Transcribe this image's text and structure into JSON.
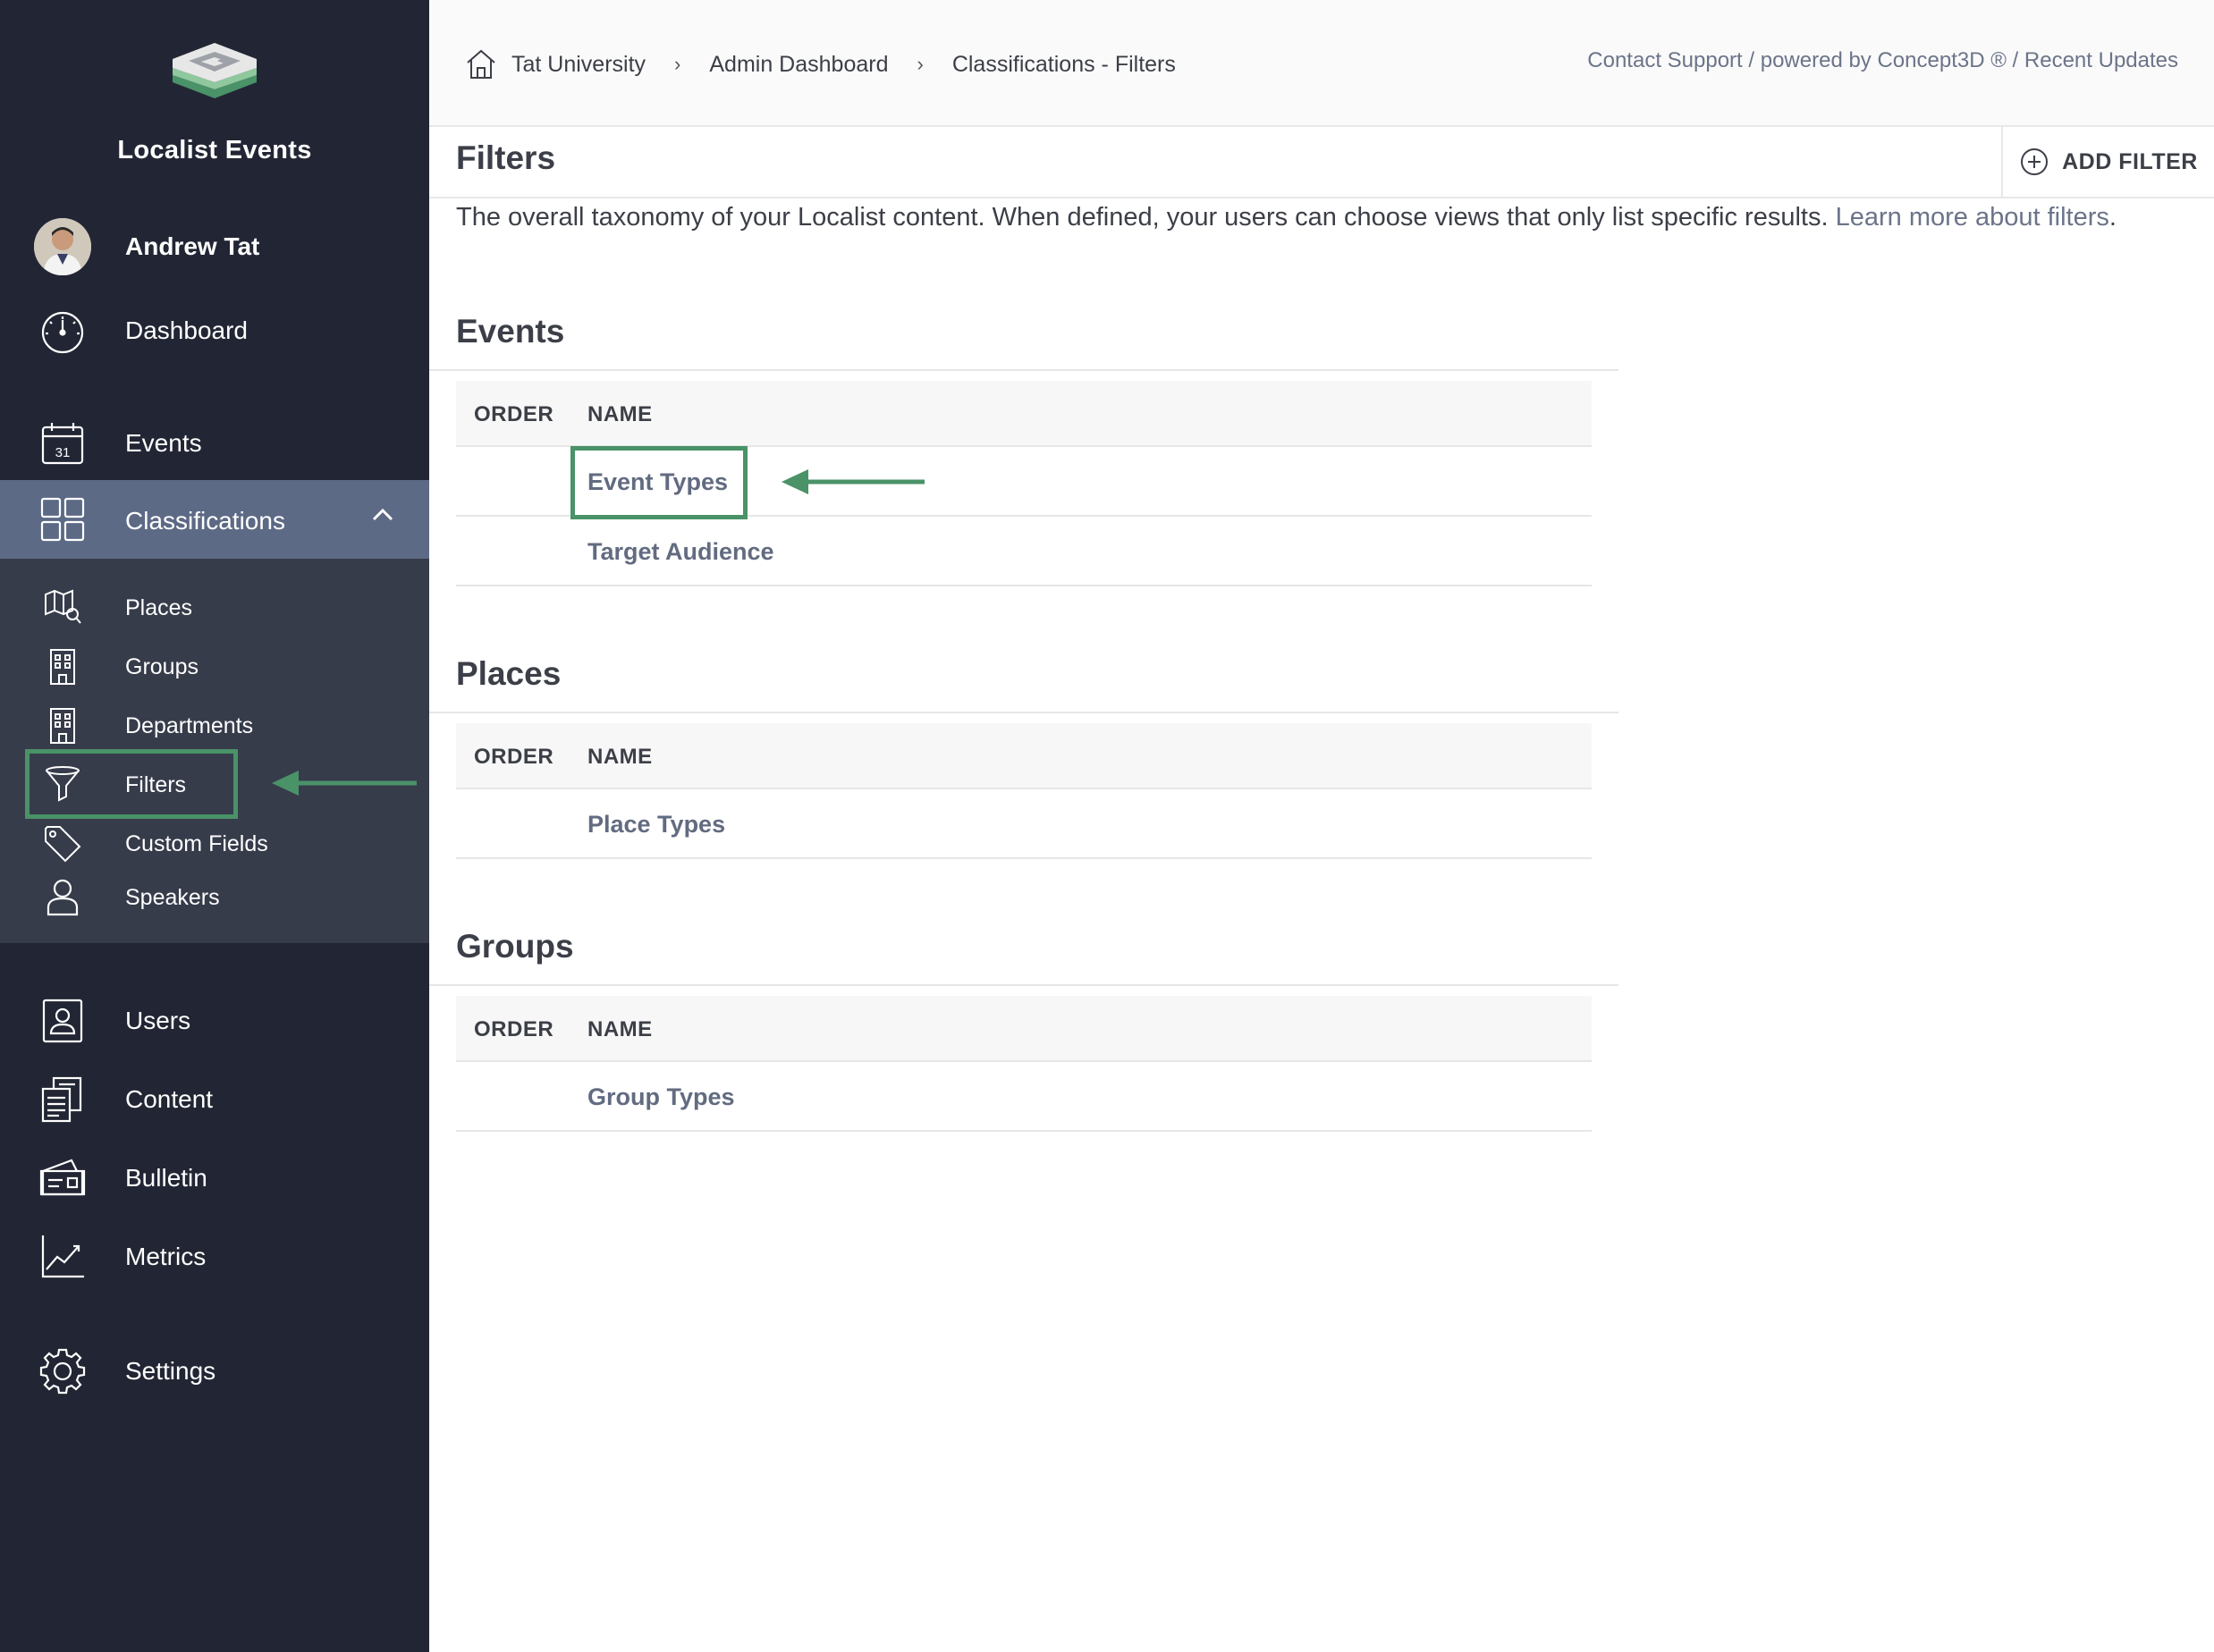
{
  "app": {
    "name": "Localist Events"
  },
  "user": {
    "name": "Andrew Tat"
  },
  "sidebar": {
    "main_items": [
      {
        "label": "Dashboard",
        "icon": "gauge-icon"
      },
      {
        "label": "Events",
        "icon": "calendar-icon",
        "calendar_day": "31"
      },
      {
        "label": "Classifications",
        "icon": "grid-icon"
      }
    ],
    "classifications_sub": [
      {
        "label": "Places",
        "icon": "map-search-icon"
      },
      {
        "label": "Groups",
        "icon": "building-icon"
      },
      {
        "label": "Departments",
        "icon": "building-icon"
      },
      {
        "label": "Filters",
        "icon": "funnel-icon"
      },
      {
        "label": "Custom Fields",
        "icon": "tag-icon"
      },
      {
        "label": "Speakers",
        "icon": "person-icon"
      }
    ],
    "bottom_items": [
      {
        "label": "Users",
        "icon": "user-card-icon"
      },
      {
        "label": "Content",
        "icon": "documents-icon"
      },
      {
        "label": "Bulletin",
        "icon": "bulletin-icon"
      },
      {
        "label": "Metrics",
        "icon": "chart-line-icon"
      },
      {
        "label": "Settings",
        "icon": "gear-icon"
      }
    ]
  },
  "breadcrumb": {
    "items": [
      "Tat University",
      "Admin Dashboard",
      "Classifications - Filters"
    ],
    "separator": "›"
  },
  "top_links": "Contact Support / powered by Concept3D ® / Recent Updates",
  "page": {
    "title": "Filters",
    "add_button": "ADD FILTER",
    "description": "The overall taxonomy of your Localist content. When defined, your users can choose views that only list specific results. ",
    "learn_more": "Learn more about filters",
    "period": "."
  },
  "table_headers": {
    "order": "ORDER",
    "name": "NAME"
  },
  "sections": [
    {
      "title": "Events",
      "rows": [
        "Event Types",
        "Target Audience"
      ]
    },
    {
      "title": "Places",
      "rows": [
        "Place Types"
      ]
    },
    {
      "title": "Groups",
      "rows": [
        "Group Types"
      ]
    }
  ],
  "colors": {
    "sidebar_bg": "#222634",
    "sidebar_group_bg": "#373c4b",
    "sidebar_active_bg": "#5d6a86",
    "highlight": "#4a9268",
    "link": "#626b80"
  }
}
